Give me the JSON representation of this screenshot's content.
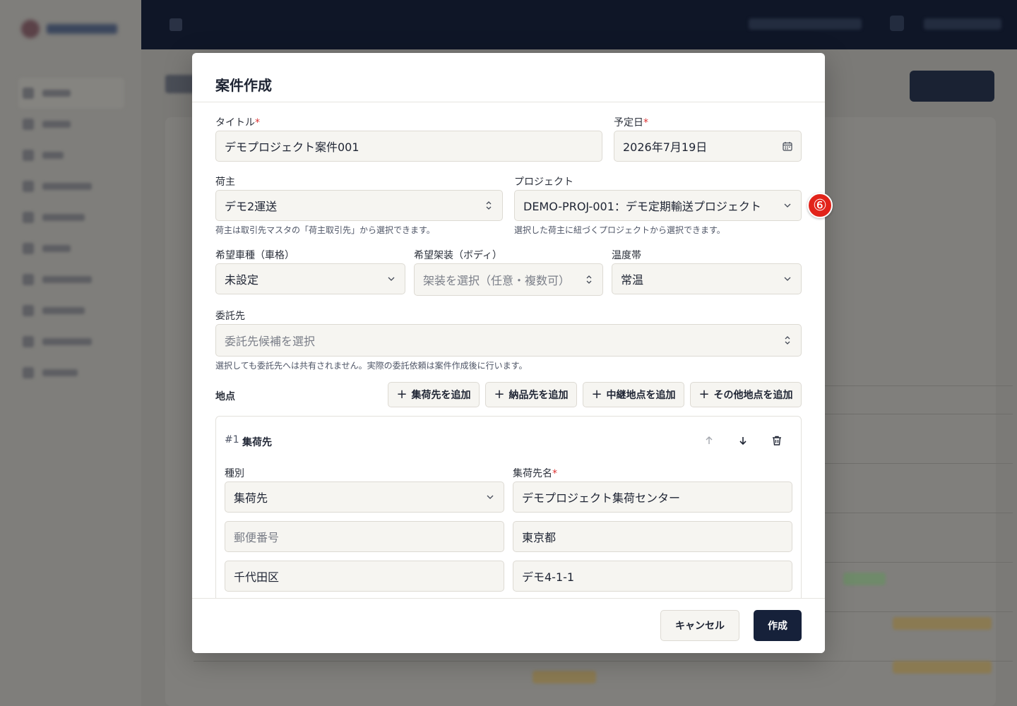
{
  "modal": {
    "title": "案件作成",
    "title_field": {
      "label": "タイトル",
      "required_mark": "*",
      "value": "デモプロジェクト案件001"
    },
    "date_field": {
      "label": "予定日",
      "required_mark": "*",
      "value": "2026年7月19日",
      "icon": "calendar-icon"
    },
    "shipper_field": {
      "label": "荷主",
      "value": "デモ2運送",
      "help": "荷主は取引先マスタの「荷主取引先」から選択できます。"
    },
    "project_field": {
      "label": "プロジェクト",
      "value": "DEMO-PROJ-001：デモ定期輸送プロジェクト",
      "help": "選択した荷主に紐づくプロジェクトから選択できます。"
    },
    "vehicle_field": {
      "label": "希望車種（車格）",
      "value": "未設定"
    },
    "body_field": {
      "label": "希望架装（ボディ）",
      "placeholder": "架装を選択（任意・複数可）"
    },
    "temperature_field": {
      "label": "温度帯",
      "value": "常温"
    },
    "contractor_field": {
      "label": "委託先",
      "placeholder": "委託先候補を選択",
      "help": "選択しても委託先へは共有されません。実際の委託依頼は案件作成後に行います。"
    },
    "locations": {
      "label": "地点",
      "add_buttons": [
        "集荷先を追加",
        "納品先を追加",
        "中継地点を追加",
        "その他地点を追加"
      ],
      "stop": {
        "index": "#1",
        "title": "集荷先",
        "type_label": "種別",
        "type_value": "集荷先",
        "name_label": "集荷先名",
        "name_required_mark": "*",
        "name_value": "デモプロジェクト集荷センター",
        "postal_placeholder": "郵便番号",
        "prefecture_value": "東京都",
        "city_value": "千代田区",
        "address_value": "デモ4-1-1"
      }
    },
    "footer": {
      "cancel_label": "キャンセル",
      "create_label": "作成"
    }
  },
  "annotation_badge": "⑥",
  "colors": {
    "primary": "#16213a",
    "required": "#dd3333",
    "badge": "#e2231a",
    "field_bg": "#f6f5f1",
    "top_bar": "#0f1627"
  }
}
